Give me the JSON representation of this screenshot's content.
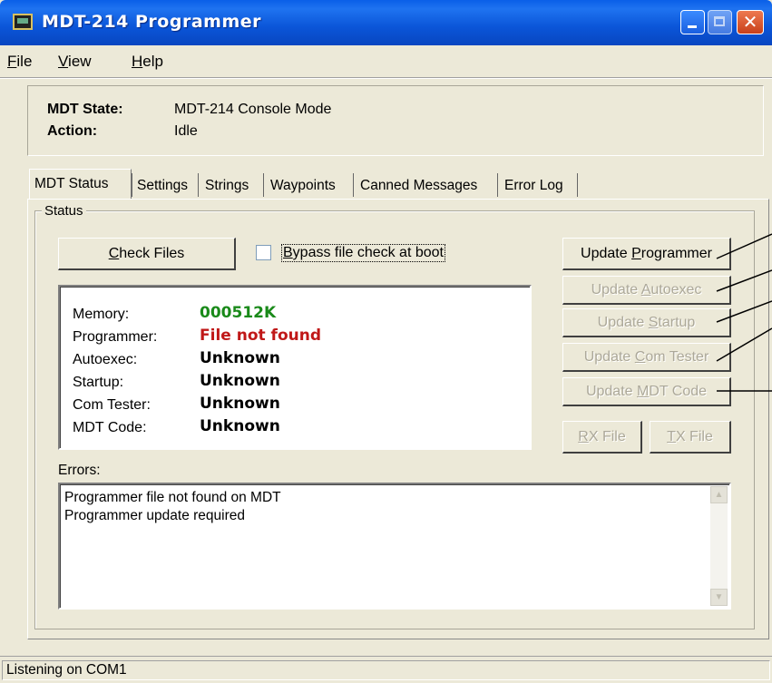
{
  "window": {
    "title": "MDT-214 Programmer"
  },
  "menu": {
    "file": "File",
    "view": "View",
    "help": "Help"
  },
  "state_panel": {
    "state_label": "MDT State:",
    "state_value": "MDT-214 Console Mode",
    "action_label": "Action:",
    "action_value": "Idle"
  },
  "tabs": [
    {
      "label": "MDT Status",
      "active": true
    },
    {
      "label": "Settings"
    },
    {
      "label": "Strings"
    },
    {
      "label": "Waypoints"
    },
    {
      "label": "Canned Messages"
    },
    {
      "label": "Error Log"
    }
  ],
  "status_group": {
    "title": "Status"
  },
  "check_files": {
    "label": "Check Files"
  },
  "bypass": {
    "label": "Bypass file check at boot",
    "checked": false
  },
  "files": [
    {
      "name": "Memory:",
      "value": "000512K",
      "color": "#1a8a1a"
    },
    {
      "name": "Programmer:",
      "value": "File not found",
      "color": "#c01818"
    },
    {
      "name": "Autoexec:",
      "value": "Unknown",
      "color": "#000000"
    },
    {
      "name": "Startup:",
      "value": "Unknown",
      "color": "#000000"
    },
    {
      "name": "Com Tester:",
      "value": "Unknown",
      "color": "#000000"
    },
    {
      "name": "MDT Code:",
      "value": "Unknown",
      "color": "#000000"
    }
  ],
  "update_buttons": [
    {
      "label": "Update Programmer",
      "enabled": true
    },
    {
      "label": "Update Autoexec",
      "enabled": false
    },
    {
      "label": "Update Startup",
      "enabled": false
    },
    {
      "label": "Update Com Tester",
      "enabled": false
    },
    {
      "label": "Update MDT Code",
      "enabled": false
    }
  ],
  "rx_button": {
    "label": "RX File",
    "enabled": false
  },
  "tx_button": {
    "label": "TX File",
    "enabled": false
  },
  "errors": {
    "label": "Errors:",
    "lines": [
      "Programmer file not found on MDT",
      "Programmer update required"
    ]
  },
  "statusbar": {
    "text": "Listening on COM1"
  }
}
